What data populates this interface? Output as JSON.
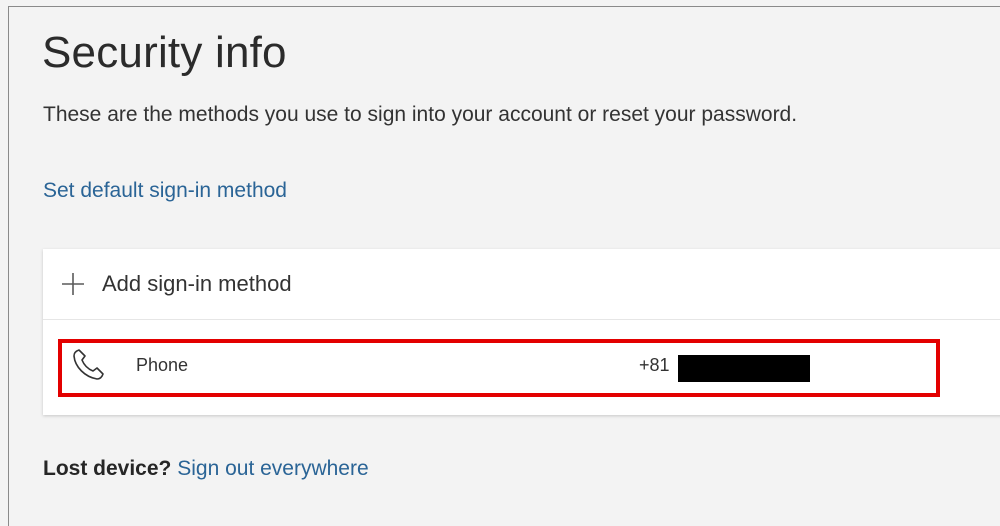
{
  "page": {
    "title": "Security info",
    "subtitle": "These are the methods you use to sign into your account or reset your password.",
    "set_default_link": "Set default sign-in method"
  },
  "card": {
    "add_label": "Add sign-in method",
    "add_icon": "plus-icon",
    "methods": [
      {
        "icon": "phone-icon",
        "name": "Phone",
        "value_prefix": "+81",
        "value_redacted": true
      }
    ]
  },
  "footer": {
    "lost_label": "Lost device?",
    "sign_out_link": "Sign out everywhere"
  },
  "colors": {
    "link": "#2a6496",
    "highlight": "#e30000",
    "background": "#f3f3f3"
  }
}
